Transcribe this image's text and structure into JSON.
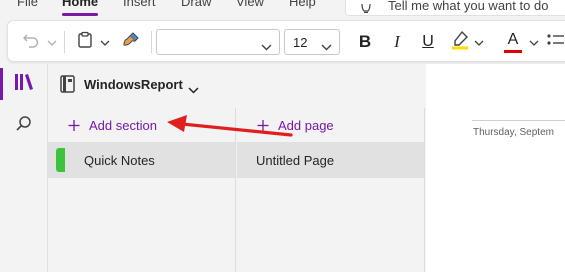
{
  "menu": {
    "tabs": [
      "File",
      "Home",
      "Insert",
      "Draw",
      "View",
      "Help"
    ],
    "active": "Home",
    "tell_me": "Tell me what you want to do"
  },
  "ribbon": {
    "font_name": "",
    "font_size": "12",
    "bold_label": "B",
    "italic_label": "I",
    "underline_label": "U",
    "font_color_label": "A",
    "highlight_color": "#f5e000",
    "font_color": "#e00000"
  },
  "notebook": {
    "name": "WindowsReport"
  },
  "sections": {
    "add_label": "Add section",
    "items": [
      {
        "label": "Quick Notes",
        "color": "#3bc33b"
      }
    ]
  },
  "pages": {
    "add_label": "Add page",
    "items": [
      {
        "label": "Untitled Page"
      }
    ]
  },
  "canvas": {
    "date": "Thursday, Septem"
  },
  "accent": "#7719aa"
}
